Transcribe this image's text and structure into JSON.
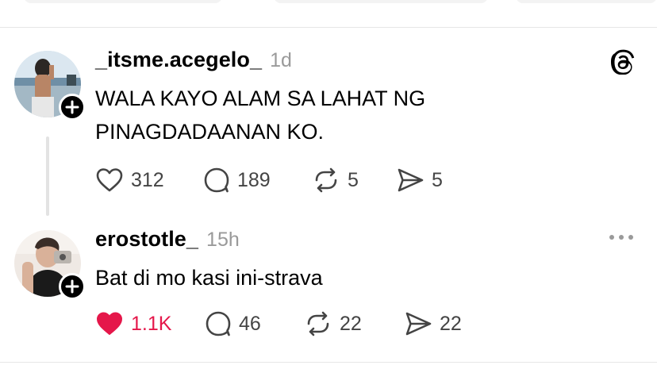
{
  "posts": [
    {
      "username": "_itsme.acegelo_",
      "time": "1d",
      "text_lines": [
        "WALA KAYO ALAM SA LAHAT NG",
        "PINAGDADAANAN KO."
      ],
      "likes": "312",
      "comments": "189",
      "reposts": "5",
      "shares": "5",
      "liked": false,
      "corner_icon": "threads-logo-icon"
    },
    {
      "username": "erostotle_",
      "time": "15h",
      "text_lines": [
        "Bat di mo kasi ini-strava"
      ],
      "likes": "1.1K",
      "comments": "46",
      "reposts": "22",
      "shares": "22",
      "liked": true,
      "corner_icon": "more-options-icon"
    }
  ],
  "colors": {
    "like_active": "#e5174a",
    "muted": "#9a9a9a",
    "text": "#000000"
  }
}
